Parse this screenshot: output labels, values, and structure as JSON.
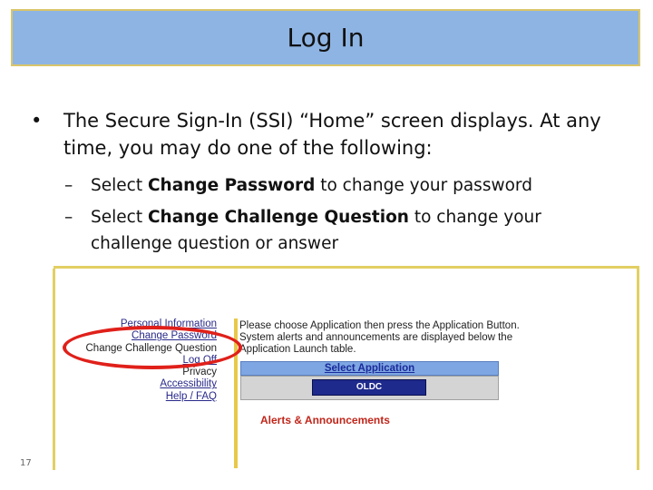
{
  "title": "Log In",
  "bullet": {
    "text": "The Secure Sign-In (SSI) “Home” screen displays. At any time, you may do one of the following:",
    "sub_items": [
      {
        "pre": "Select ",
        "bold": "Change Password",
        "post": " to change your password"
      },
      {
        "pre": "Select ",
        "bold": "Change Challenge Question",
        "post": " to change your challenge question or answer"
      }
    ]
  },
  "screenshot": {
    "nav_items": [
      "Personal Information",
      "Change Password",
      "Change Challenge Question",
      "Log Off",
      "Privacy",
      "Accessibility",
      "Help / FAQ"
    ],
    "message": "Please choose Application then press the Application Button. System alerts and announcements are displayed below the Application Launch table.",
    "select_application": "Select Application",
    "app_button": "OLDC",
    "alerts_heading": "Alerts & Announcements",
    "highlight_color": "#e0201a"
  },
  "page_number": "17"
}
